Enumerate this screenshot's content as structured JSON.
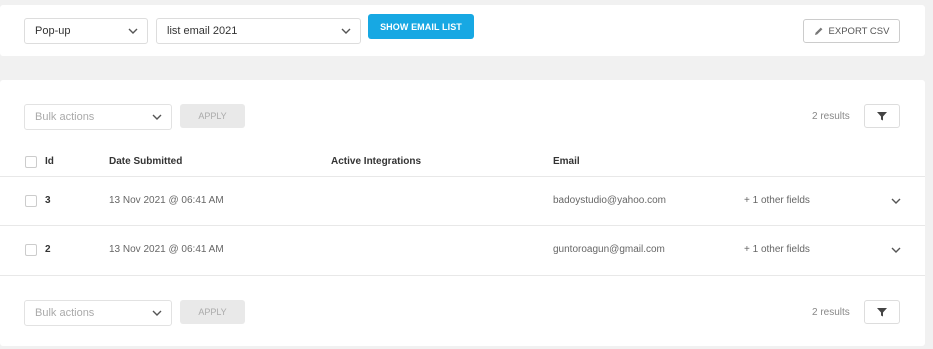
{
  "toolbar": {
    "module_select": "Pop-up",
    "list_select": "list email 2021",
    "show_button": "SHOW EMAIL LIST",
    "export_button": "EXPORT CSV"
  },
  "controls_top": {
    "bulk_select": "Bulk actions",
    "apply_button": "APPLY",
    "results": "2 results"
  },
  "table": {
    "headers": {
      "id": "Id",
      "date": "Date Submitted",
      "integrations": "Active Integrations",
      "email": "Email"
    },
    "rows": [
      {
        "id": "3",
        "date": "13 Nov 2021 @ 06:41 AM",
        "email": "badoystudio@yahoo.com",
        "other": "+ 1 other fields"
      },
      {
        "id": "2",
        "date": "13 Nov 2021 @ 06:41 AM",
        "email": "guntoroagun@gmail.com",
        "other": "+ 1 other fields"
      }
    ]
  },
  "controls_bottom": {
    "bulk_select": "Bulk actions",
    "apply_button": "APPLY",
    "results": "2 results"
  },
  "icons": {
    "dropdown": "chevron-down-icon",
    "export": "pencil-icon",
    "filter": "funnel-icon",
    "expand": "chevron-down-icon"
  },
  "colors": {
    "accent": "#17a8e3",
    "background": "#f1f1f1",
    "panel": "#ffffff"
  }
}
